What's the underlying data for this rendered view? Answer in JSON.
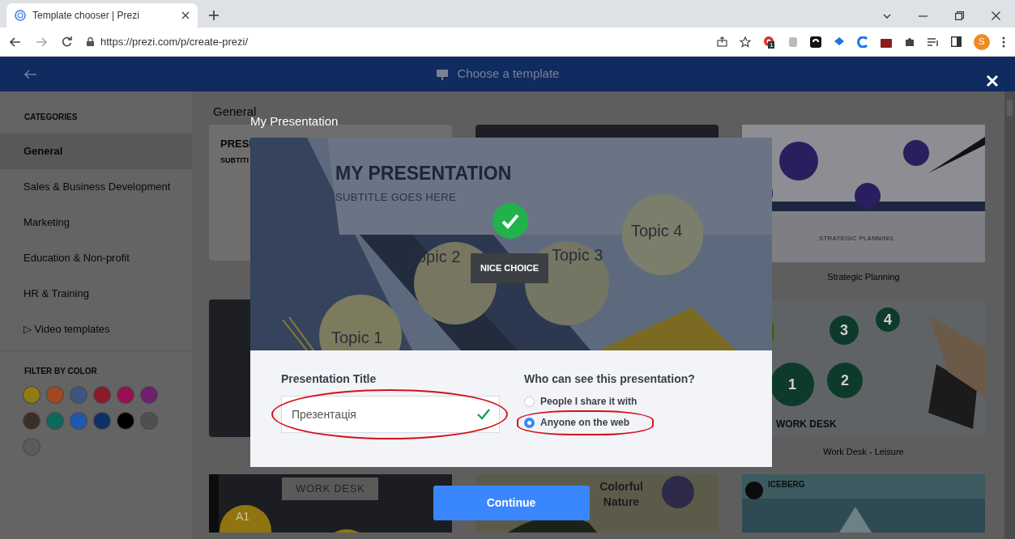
{
  "browser": {
    "tab_title": "Template chooser | Prezi",
    "url": "https://prezi.com/p/create-prezi/",
    "profile_initial": "S",
    "extension_badge": "1"
  },
  "header": {
    "title": "Choose a template"
  },
  "sidebar": {
    "categories_heading": "CATEGORIES",
    "categories": [
      {
        "label": "General",
        "selected": true
      },
      {
        "label": "Sales & Business Development",
        "selected": false
      },
      {
        "label": "Marketing",
        "selected": false
      },
      {
        "label": "Education & Non-profit",
        "selected": false
      },
      {
        "label": "HR & Training",
        "selected": false
      },
      {
        "label": "▷ Video templates",
        "selected": false
      }
    ],
    "filter_heading": "FILTER BY COLOR",
    "colors": [
      {
        "color": "#8f7d12"
      },
      {
        "color": "#a0481f"
      },
      {
        "color": "#3f5580"
      },
      {
        "color": "#8c1a2a"
      },
      {
        "color": "#990f55"
      },
      {
        "color": "#6c2170"
      },
      {
        "color": "#3a2e28"
      },
      {
        "color": "#0b6a5c"
      },
      {
        "color": "#1f58b0"
      },
      {
        "color": "#0d3066"
      },
      {
        "color": "#000000"
      },
      {
        "color": "#4f4f4f"
      },
      {
        "color": "#5c5c5c"
      }
    ]
  },
  "content": {
    "section_title": "General",
    "templates": [
      {
        "kind": "plain",
        "texts": [
          "PRESI",
          "SUBTITI"
        ]
      },
      {
        "kind": "dark"
      },
      {
        "kind": "planning",
        "texts": [
          "STRATEGIC PLANNING"
        ],
        "caption": "Strategic Planning"
      },
      {
        "kind": "dark"
      },
      {
        "kind": "workdesk",
        "texts": [
          "1",
          "2",
          "3",
          "4",
          "WORK DESK"
        ],
        "caption": "Work Desk - Leisure"
      },
      {
        "kind": "darkdesk",
        "texts": [
          "WORK DESK",
          "A1"
        ]
      },
      {
        "kind": "nature",
        "texts": [
          "Colorful Nature"
        ]
      },
      {
        "kind": "iceberg",
        "texts": [
          "ICEBERG"
        ]
      }
    ]
  },
  "modal": {
    "title": "My Presentation",
    "preview": {
      "heading": "MY PRESENTATION",
      "subtitle": "SUBTITLE GOES HERE",
      "topics": [
        "Topic 1",
        "Topic 2",
        "Topic 3",
        "Topic 4"
      ],
      "badge": "NICE CHOICE"
    },
    "form": {
      "title_label": "Presentation Title",
      "title_value": "Презентація",
      "title_valid": true,
      "title_highlighted": true,
      "visibility_label": "Who can see this presentation?",
      "options": [
        {
          "label": "People I share it with",
          "selected": false,
          "highlighted": false
        },
        {
          "label": "Anyone on the web",
          "selected": true,
          "highlighted": true
        }
      ]
    },
    "continue": "Continue"
  }
}
